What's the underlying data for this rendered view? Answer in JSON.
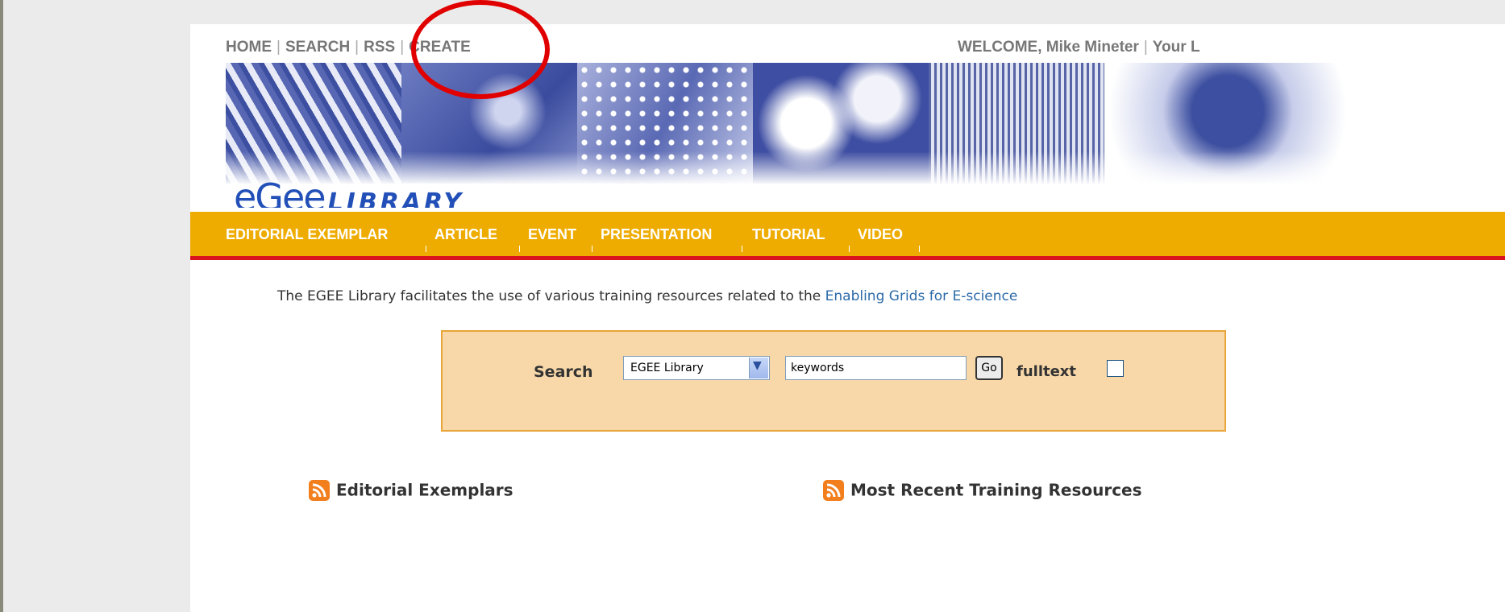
{
  "top_nav": {
    "items": [
      "HOME",
      "SEARCH",
      "RSS",
      "CREATE"
    ],
    "separator": "|"
  },
  "welcome": {
    "text": "WELCOME, Mike Mineter",
    "trail": "Your L"
  },
  "logo": {
    "mark": "eGee",
    "word": "LIBRARY"
  },
  "categories": [
    "EDITORIAL EXEMPLAR",
    "ARTICLE",
    "EVENT",
    "PRESENTATION",
    "TUTORIAL",
    "VIDEO"
  ],
  "intro": {
    "text": "The EGEE Library facilitates the use of various training resources related to the ",
    "link": "Enabling Grids for E-science"
  },
  "search": {
    "label": "Search",
    "select_value": "EGEE Library",
    "keywords_value": "keywords",
    "go_label": "Go",
    "fulltext_label": "fulltext",
    "fulltext_checked": false
  },
  "feeds": {
    "left": "Editorial Exemplars",
    "right": "Most Recent Training Resources"
  },
  "colors": {
    "category_bar": "#efac00",
    "category_underline": "#d9141e",
    "search_bg": "#f8d8a8",
    "link": "#2b6aa8",
    "highlight": "#e10000"
  }
}
